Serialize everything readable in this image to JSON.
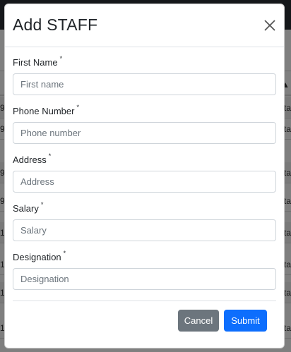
{
  "background": {
    "header_icon": "▲",
    "rows": [
      {
        "left": "9",
        "right": "ta"
      },
      {
        "left": "9",
        "right": "ta"
      },
      {
        "left": "9",
        "right": "ta"
      },
      {
        "left": "9",
        "right": "ta"
      },
      {
        "left": "1",
        "right": "ta"
      },
      {
        "left": "1",
        "right": "ta"
      },
      {
        "left": "1",
        "right": "ta"
      },
      {
        "left": "1",
        "right": "ta"
      }
    ]
  },
  "modal": {
    "title": "Add STAFF",
    "close_icon": "×",
    "required_mark": "*",
    "fields": [
      {
        "label": "First Name",
        "placeholder": "First name",
        "value": ""
      },
      {
        "label": "Phone Number",
        "placeholder": "Phone number",
        "value": ""
      },
      {
        "label": "Address",
        "placeholder": "Address",
        "value": ""
      },
      {
        "label": "Salary",
        "placeholder": "Salary",
        "value": ""
      },
      {
        "label": "Designation",
        "placeholder": "Designation",
        "value": ""
      }
    ],
    "cancel_label": "Cancel",
    "submit_label": "Submit"
  },
  "colors": {
    "primary": "#0d6efd",
    "secondary": "#6c757d",
    "navbar": "#2a2f34"
  }
}
